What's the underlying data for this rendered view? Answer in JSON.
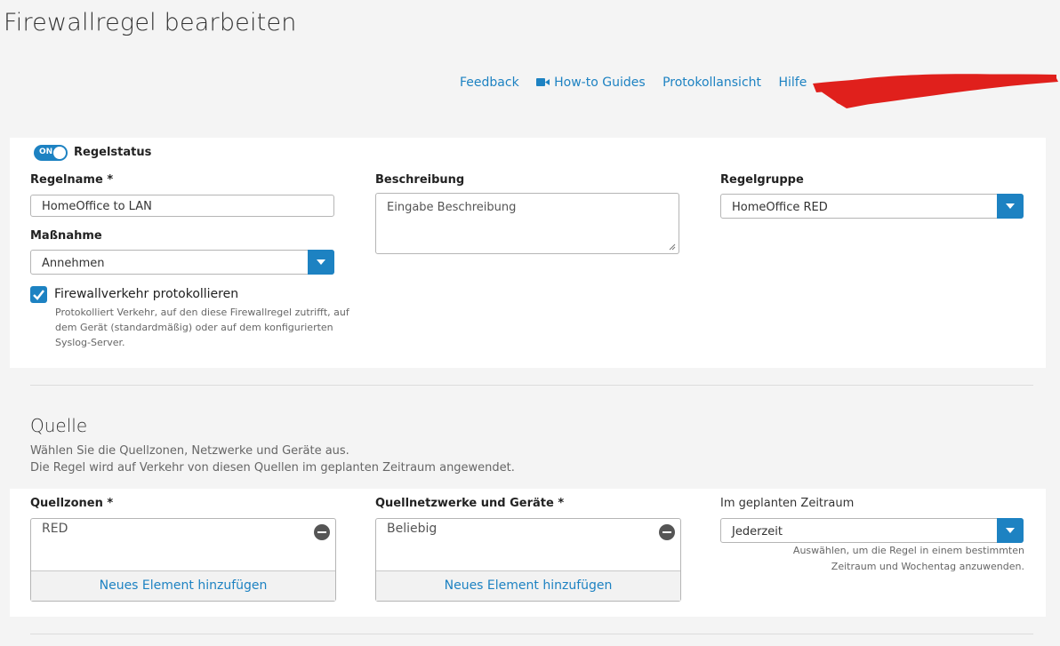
{
  "page": {
    "title": "Firewallregel bearbeiten"
  },
  "toplinks": {
    "feedback": "Feedback",
    "howto": "How-to Guides",
    "protokoll": "Protokollansicht",
    "hilfe": "Hilfe"
  },
  "rule": {
    "status_toggle": "ON",
    "status_label": "Regelstatus",
    "name_label": "Regelname *",
    "name_value": "HomeOffice to LAN",
    "description_label": "Beschreibung",
    "description_placeholder": "Eingabe Beschreibung",
    "group_label": "Regelgruppe",
    "group_value": "HomeOffice RED",
    "action_label": "Maßnahme",
    "action_value": "Annehmen",
    "log_label": "Firewallverkehr protokollieren",
    "log_help": [
      "Protokolliert Verkehr, auf den diese Firewallregel zutrifft, auf",
      "dem Gerät (standardmäßig) oder auf dem konfigurierten",
      "Syslog-Server."
    ]
  },
  "source": {
    "title": "Quelle",
    "desc": [
      "Wählen Sie die Quellzonen, Netzwerke und Geräte aus.",
      "Die Regel wird auf Verkehr von diesen Quellen im geplanten Zeitraum angewendet."
    ],
    "zones_label": "Quellzonen *",
    "zones_item": "RED",
    "networks_label": "Quellnetzwerke und Geräte *",
    "networks_item": "Beliebig",
    "add_label": "Neues Element hinzufügen",
    "schedule_label": "Im geplanten Zeitraum",
    "schedule_value": "Jederzeit",
    "schedule_help": [
      "Auswählen, um die Regel in einem bestimmten",
      "Zeitraum und Wochentag anzuwenden."
    ]
  },
  "colors": {
    "accent": "#1d82c2",
    "redaction": "#e0201c"
  }
}
